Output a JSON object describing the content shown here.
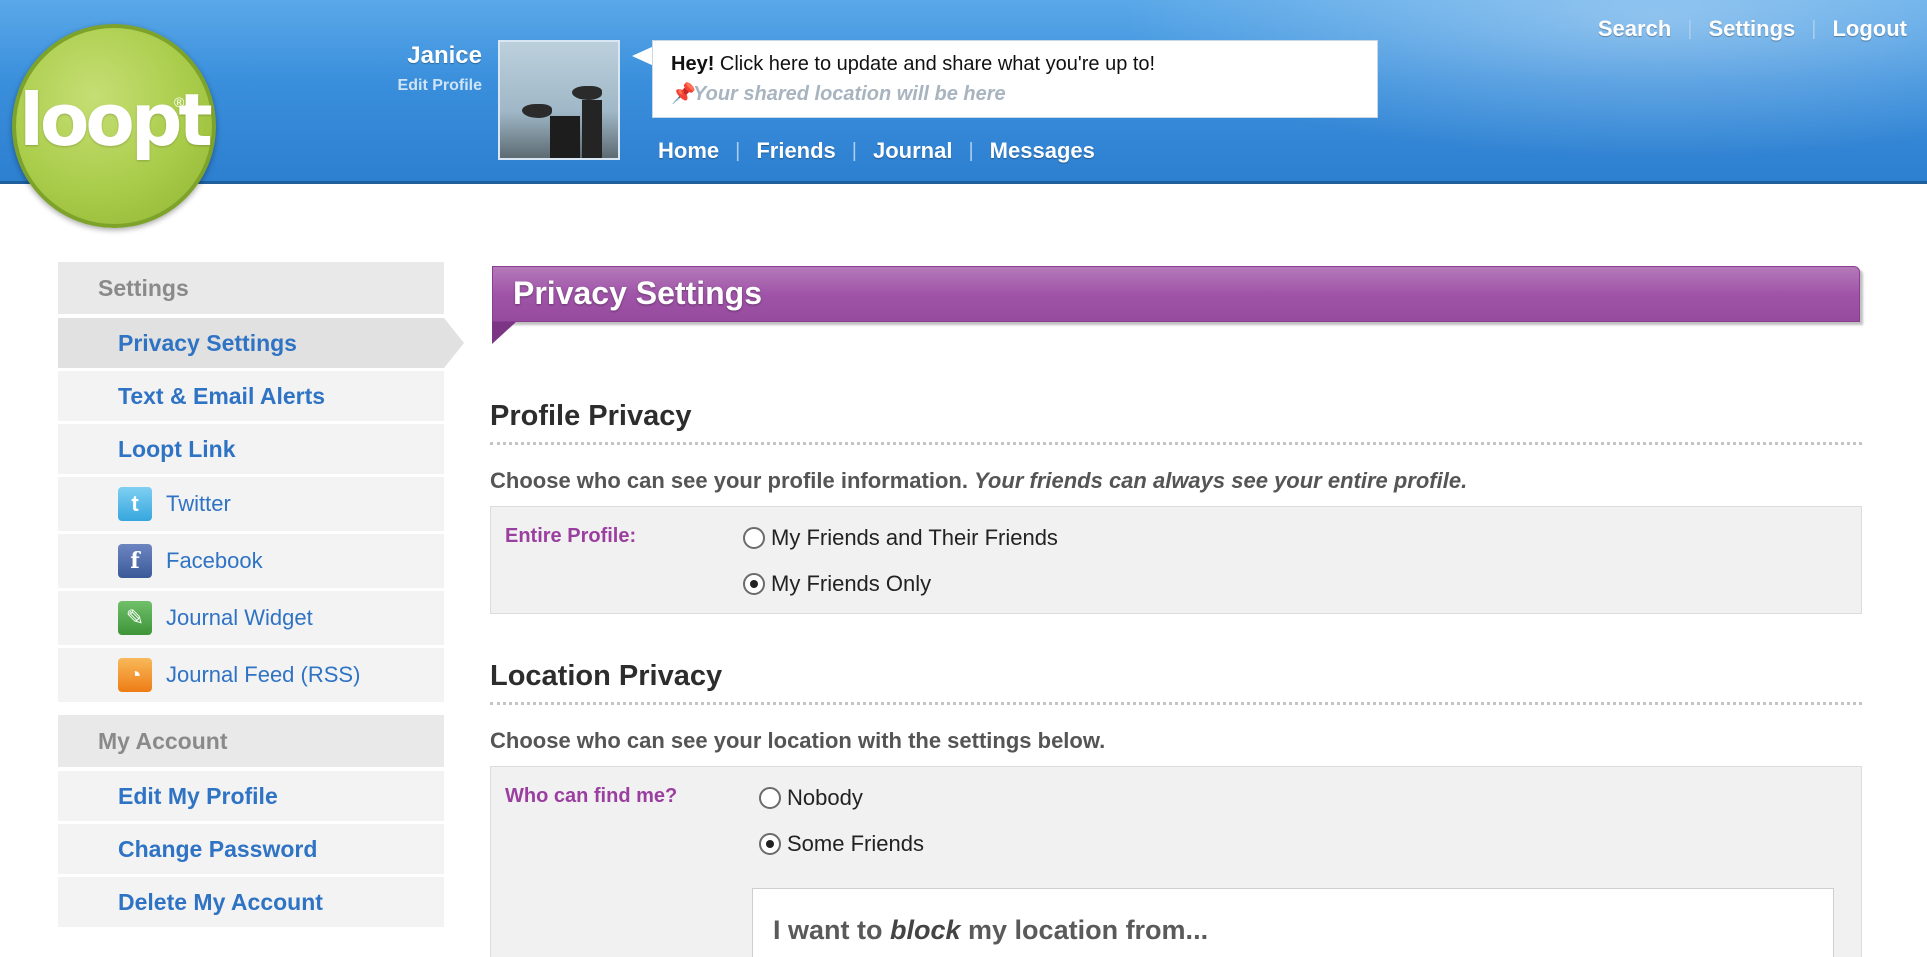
{
  "brand": {
    "logo_text": "loopt",
    "logo_reg": "®"
  },
  "user": {
    "name": "Janice",
    "edit_profile": "Edit Profile"
  },
  "status": {
    "prefix": "Hey!",
    "prompt": " Click here to update and share what you're up to!",
    "location_placeholder": "Your shared location will be here"
  },
  "main_nav": [
    "Home",
    "Friends",
    "Journal",
    "Messages"
  ],
  "top_links": [
    "Search",
    "Settings",
    "Logout"
  ],
  "sidebar": {
    "settings_heading": "Settings",
    "settings_items": [
      {
        "label": "Privacy Settings",
        "active": true
      },
      {
        "label": "Text & Email Alerts"
      },
      {
        "label": "Loopt Link"
      }
    ],
    "link_items": [
      {
        "label": "Twitter",
        "icon": "twitter-icon",
        "glyph": "t"
      },
      {
        "label": "Facebook",
        "icon": "facebook-icon",
        "glyph": "f"
      },
      {
        "label": "Journal Widget",
        "icon": "journal-widget-icon",
        "glyph": "✎"
      },
      {
        "label": "Journal Feed (RSS)",
        "icon": "rss-icon",
        "glyph": "◔"
      }
    ],
    "account_heading": "My Account",
    "account_items": [
      "Edit My Profile",
      "Change Password",
      "Delete My Account"
    ]
  },
  "page_title": "Privacy Settings",
  "profile_privacy": {
    "title": "Profile Privacy",
    "desc": "Choose who can see your profile information. ",
    "desc_italic": "Your friends can always see your entire profile.",
    "label": "Entire Profile:",
    "options": [
      "My Friends and Their Friends",
      "My Friends Only"
    ],
    "selected": "My Friends Only"
  },
  "location_privacy": {
    "title": "Location Privacy",
    "desc": "Choose who can see your location with the settings below.",
    "label": "Who can find me?",
    "options": [
      "Nobody",
      "Some Friends"
    ],
    "selected": "Some Friends",
    "block_prefix": "I want to ",
    "block_italic": "block",
    "block_suffix": " my location from..."
  }
}
